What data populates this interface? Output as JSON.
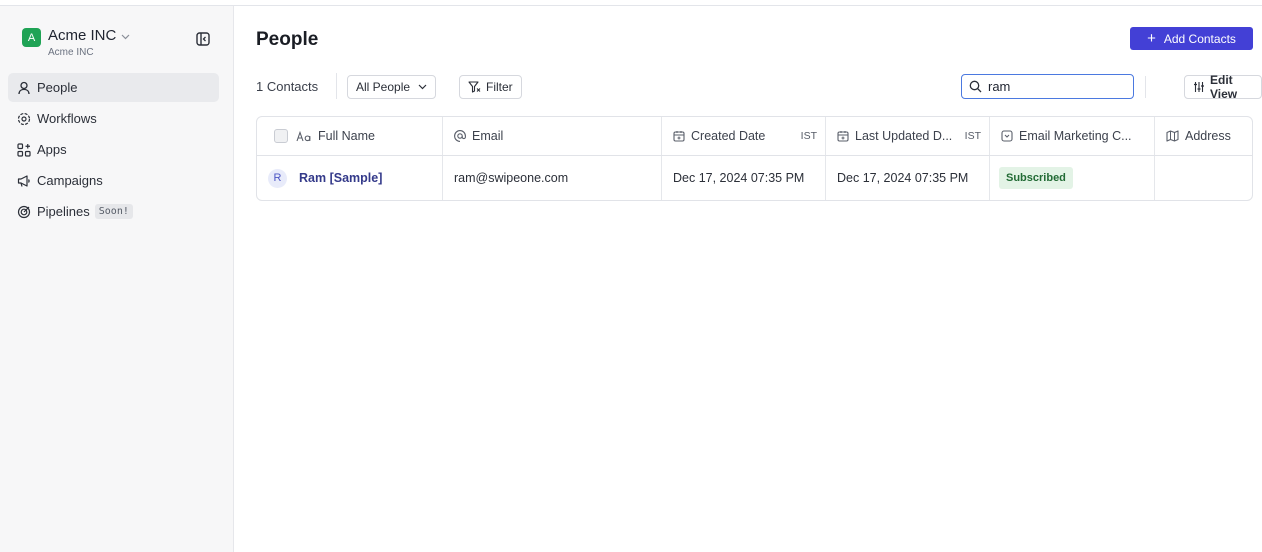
{
  "workspace": {
    "initial": "A",
    "name": "Acme INC",
    "sub": "Acme INC"
  },
  "nav": [
    {
      "label": "People",
      "icon": "person-icon"
    },
    {
      "label": "Workflows",
      "icon": "workflow-icon"
    },
    {
      "label": "Apps",
      "icon": "apps-icon"
    },
    {
      "label": "Campaigns",
      "icon": "megaphone-icon"
    },
    {
      "label": "Pipelines",
      "icon": "target-icon",
      "badge": "Soon!"
    }
  ],
  "page": {
    "title": "People",
    "add_button": "Add Contacts",
    "contacts_count": "1 Contacts",
    "view_select": "All People",
    "filter_label": "Filter",
    "search_value": "ram",
    "edit_view_label": "Edit View"
  },
  "table": {
    "columns": [
      {
        "label": "Full Name",
        "icon": "text-aa-icon"
      },
      {
        "label": "Email",
        "icon": "at-icon"
      },
      {
        "label": "Created Date",
        "icon": "calendar-icon",
        "tz": "IST"
      },
      {
        "label": "Last Updated D...",
        "icon": "calendar-icon",
        "tz": "IST"
      },
      {
        "label": "Email Marketing C...",
        "icon": "dropdown-box-icon"
      },
      {
        "label": "Address",
        "icon": "map-icon"
      }
    ],
    "rows": [
      {
        "initial": "R",
        "name": "Ram [Sample]",
        "email": "ram@swipeone.com",
        "created": "Dec 17, 2024 07:35 PM",
        "updated": "Dec 17, 2024 07:35 PM",
        "marketing": "Subscribed",
        "address": ""
      }
    ]
  },
  "colors": {
    "accent": "#4340d6",
    "workspace_badge": "#1fa355",
    "subscribed_bg": "#e3f3e6",
    "subscribed_text": "#226b35"
  }
}
